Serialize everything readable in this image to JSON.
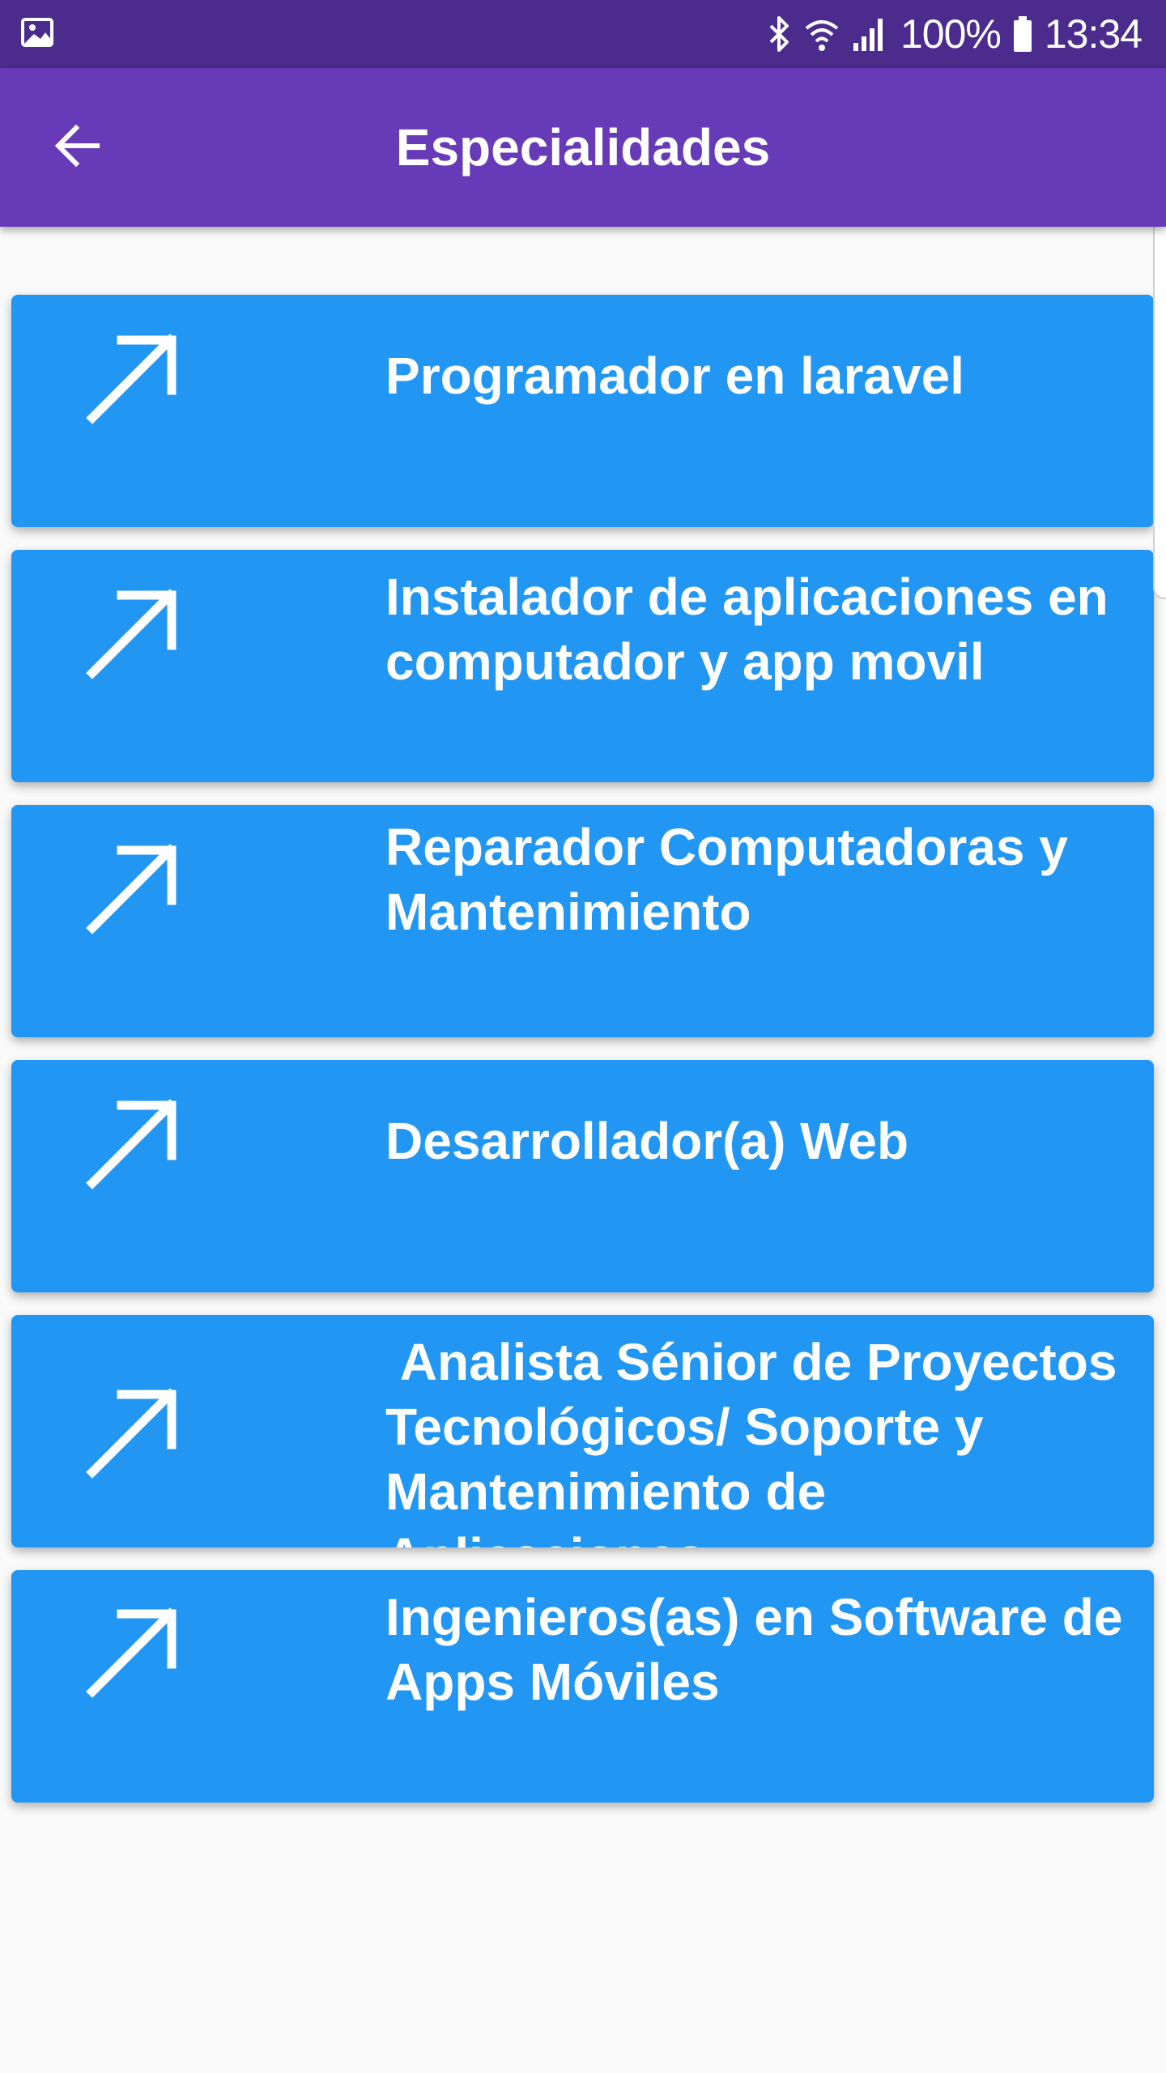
{
  "status_bar": {
    "left_icon": "image-icon",
    "battery_percent": "100%",
    "time": "13:34",
    "icons": [
      "bluetooth-icon",
      "wifi-icon",
      "signal-icon",
      "battery-icon"
    ]
  },
  "app_bar": {
    "title": "Especialidades",
    "back_icon": "arrow-back-icon"
  },
  "colors": {
    "status_bar": "#4b2c8c",
    "app_bar": "#673ab7",
    "card": "#2196f3",
    "background": "#fafafa",
    "text_on_color": "#ffffff"
  },
  "specialties": [
    {
      "title": "Programador en laravel",
      "icon": "arrow-up-right-icon"
    },
    {
      "title": "Instalador de aplicaciones en computador y app movil",
      "icon": "arrow-up-right-icon"
    },
    {
      "title": "Reparador Computadoras y Mantenimiento",
      "icon": "arrow-up-right-icon"
    },
    {
      "title": "Desarrollador(a) Web",
      "icon": "arrow-up-right-icon"
    },
    {
      "title": " Analista Sénior de Proyectos Tecnológicos/ Soporte y Mantenimiento de Aplicaciones",
      "icon": "arrow-up-right-icon"
    },
    {
      "title": "Ingenieros(as) en Software de Apps Móviles",
      "icon": "arrow-up-right-icon"
    }
  ]
}
